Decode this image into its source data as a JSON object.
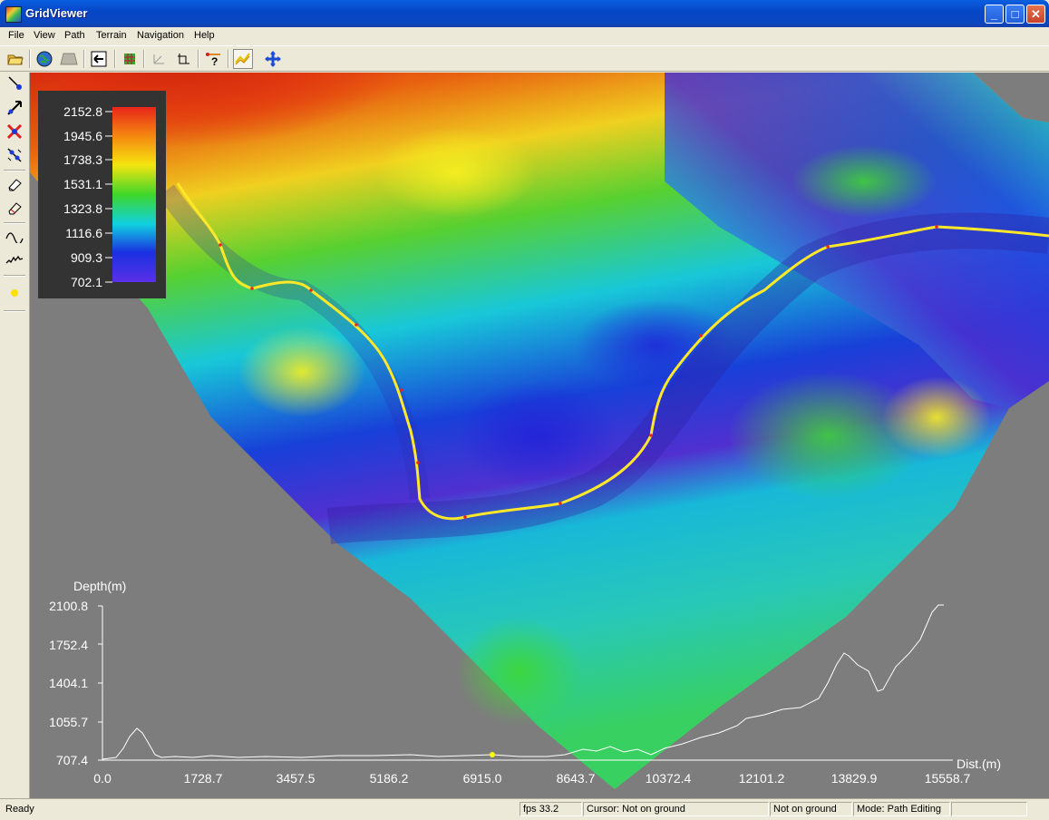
{
  "window": {
    "title": "GridViewer",
    "buttons": {
      "minimize": "_",
      "maximize": "□",
      "close": "✕"
    }
  },
  "menu": [
    "File",
    "View",
    "Path",
    "Terrain",
    "Navigation",
    "Help"
  ],
  "toolbar": {
    "icons": [
      "open-folder-icon",
      "globe-icon",
      "terrain-flat-icon",
      "back-arrow-icon",
      "grid-icon",
      "axis-icon",
      "axis-corner-icon",
      "path-query-icon",
      "path-profile-icon",
      "move-cross-icon"
    ]
  },
  "sidebar": {
    "icons": [
      "add-point-icon",
      "move-point-icon",
      "delete-point-icon",
      "merge-points-icon",
      "eraser-icon",
      "eraser-all-icon",
      "smooth-curve-icon",
      "jagged-curve-icon",
      "marker-dot-icon"
    ]
  },
  "legend": {
    "labels": [
      "2152.8",
      "1945.6",
      "1738.3",
      "1531.1",
      "1323.8",
      "1116.6",
      "909.3",
      "702.1"
    ],
    "colors": [
      "#e8251a",
      "#f58a10",
      "#f5e410",
      "#3fd72a",
      "#10d0e0",
      "#1a30e0",
      "#5a30e8"
    ]
  },
  "profile": {
    "y_label": "Depth(m)",
    "x_label": "Dist.(m)",
    "y_ticks": [
      "2100.8",
      "1752.4",
      "1404.1",
      "1055.7",
      "707.4"
    ],
    "x_ticks": [
      "0.0",
      "1728.7",
      "3457.5",
      "5186.2",
      "6915.0",
      "8643.7",
      "10372.4",
      "12101.2",
      "13829.9",
      "15558.7"
    ],
    "line_color": "#ffffff",
    "marker_color": "#ffff00"
  },
  "status": {
    "ready": "Ready",
    "fps": "fps 33.2",
    "cursor": "Cursor: Not on ground",
    "ground": "Not on ground",
    "mode": "Mode: Path Editing",
    "extra": ""
  }
}
